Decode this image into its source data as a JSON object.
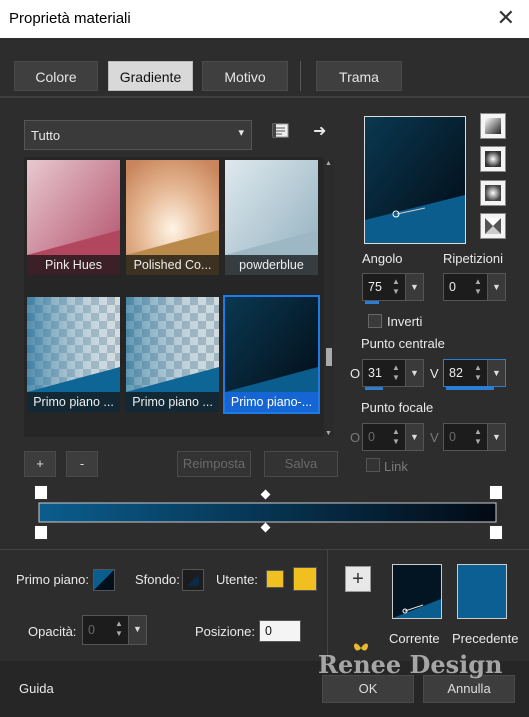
{
  "window": {
    "title": "Proprietà materiali",
    "close": "✕"
  },
  "tabs": [
    {
      "label": "Colore",
      "selected": false
    },
    {
      "label": "Gradiente",
      "selected": true
    },
    {
      "label": "Motivo",
      "selected": false
    },
    {
      "label": "Trama",
      "selected": false
    }
  ],
  "category": {
    "value": "Tutto",
    "caret": "▾"
  },
  "icons": {
    "arrow": "➜",
    "plus": "+",
    "up": "▲",
    "down": "▼",
    "caret": "▾"
  },
  "thumbnails": [
    {
      "label": "Pink Hues"
    },
    {
      "label": "Polished Co..."
    },
    {
      "label": "powderblue"
    },
    {
      "label": "Primo piano ..."
    },
    {
      "label": "Primo piano ..."
    },
    {
      "label": "Primo piano-..."
    }
  ],
  "list_buttons": {
    "add": "+",
    "remove": "-",
    "reset": "Reimposta",
    "save": "Salva"
  },
  "angle": {
    "label": "Angolo",
    "value": "75"
  },
  "repeats": {
    "label": "Ripetizioni",
    "value": "0"
  },
  "invert": {
    "label": "Inverti"
  },
  "center_point": {
    "label": "Punto centrale",
    "h_label": "O",
    "h_value": "31",
    "v_label": "V",
    "v_value": "82"
  },
  "focal_point": {
    "label": "Punto focale",
    "h_label": "O",
    "h_value": "0",
    "v_label": "V",
    "v_value": "0"
  },
  "link": {
    "label": "Link"
  },
  "bottom": {
    "foreground_label": "Primo piano:",
    "background_label": "Sfondo:",
    "user_label": "Utente:",
    "opacity_label": "Opacità:",
    "opacity_value": "0",
    "position_label": "Posizione:",
    "position_value": "0",
    "current_label": "Corrente",
    "previous_label": "Precedente"
  },
  "footer": {
    "help": "Guida",
    "ok": "OK",
    "cancel": "Annulla",
    "watermark": "Renee Design"
  },
  "colors": {
    "accent": "#1e7be6",
    "gradient_dark": "#020d1a",
    "gradient_blue": "#0a5c8a",
    "user_yellow": "#f0c020",
    "previous_blue": "#0b5f93"
  }
}
